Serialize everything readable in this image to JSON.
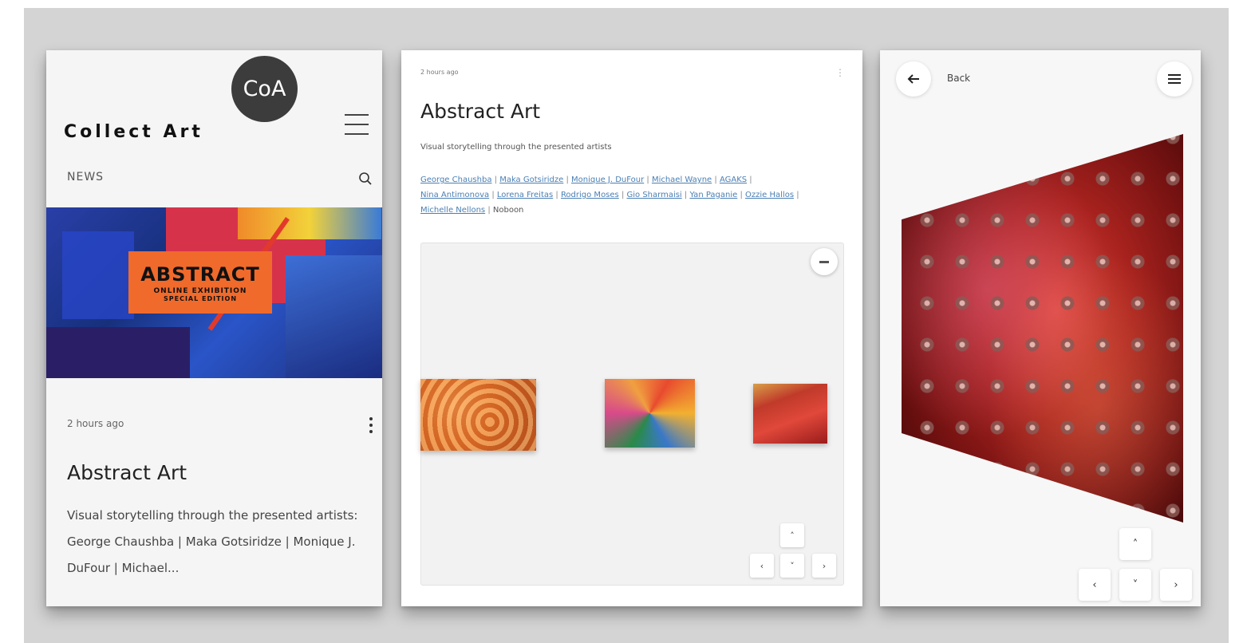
{
  "screen1": {
    "logo_text": "CoA",
    "brand": "Collect Art",
    "section_label": "NEWS",
    "hero": {
      "title": "ABSTRACT",
      "line2": "ONLINE EXHIBITION",
      "line3": "SPECIAL EDITION"
    },
    "post_time": "2 hours ago",
    "title": "Abstract Art",
    "description": "Visual storytelling through the presented artists: George Chaushba | Maka Gotsiridze | Monique J. DuFour | Michael..."
  },
  "screen2": {
    "breadcrumb": "2 hours ago",
    "more": "⋮",
    "title": "Abstract Art",
    "subtitle": "Visual storytelling through the presented artists",
    "artists": [
      {
        "name": "George Chaushba",
        "link": true
      },
      {
        "name": "Maka Gotsiridze",
        "link": true
      },
      {
        "name": "Monique J. DuFour",
        "link": true
      },
      {
        "name": "Michael Wayne",
        "link": true
      },
      {
        "name": "AGAKS",
        "link": true
      },
      {
        "name": "Nina Antimonova",
        "link": true
      },
      {
        "name": "Lorena Freitas",
        "link": true
      },
      {
        "name": "Rodrigo Moses",
        "link": true
      },
      {
        "name": "Gio Sharmaisi",
        "link": true
      },
      {
        "name": "Yan Paganie",
        "link": true
      },
      {
        "name": "Ozzie Hallos",
        "link": true
      },
      {
        "name": "Michelle Nellons",
        "link": true
      },
      {
        "name": "Noboon",
        "link": false
      }
    ],
    "zoom_icon": "minus-icon",
    "nav": {
      "up": "˄",
      "left": "‹",
      "down": "˅",
      "right": "›"
    }
  },
  "screen3": {
    "back_label": "Back",
    "nav": {
      "up": "˄",
      "left": "‹",
      "down": "˅",
      "right": "›"
    }
  }
}
